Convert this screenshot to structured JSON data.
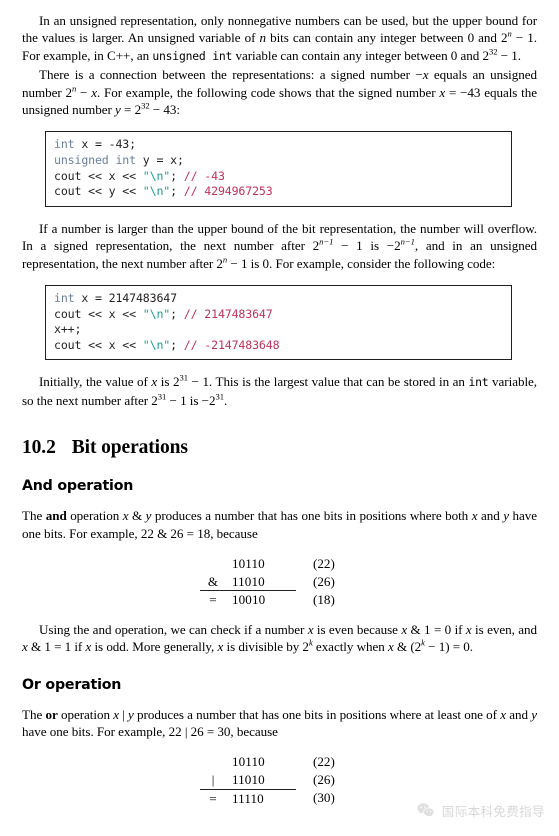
{
  "document": {
    "paragraphs": {
      "p1": {
        "seg1": "In an unsigned representation, only nonnegative numbers can be used, but the upper bound for the values is larger. An unsigned variable of ",
        "var_n": "n",
        "seg2": " bits can contain any integer between 0 and 2",
        "exp_n": "n",
        "seg3": " − 1. For example, in C++, an ",
        "code_unsigned_int": "unsigned int",
        "seg4": " variable can contain any integer between 0 and 2",
        "exp_32": "32",
        "seg5": " − 1."
      },
      "p2": {
        "seg1": "There is a connection between the representations: a signed number −",
        "var_x1": "x",
        "seg2": " equals an unsigned number 2",
        "exp_n": "n",
        "seg3": " − ",
        "var_x2": "x",
        "seg4": ". For example, the following code shows that the signed number ",
        "var_x3": "x",
        "seg5": " = −43 equals the unsigned number ",
        "var_y": "y",
        "seg6": " = 2",
        "exp_32": "32",
        "seg7": " − 43:"
      },
      "p3": {
        "seg1": "If a number is larger than the upper bound of the bit representation, the number will overflow. In a signed representation, the next number after 2",
        "exp_nm1_a": "n−1",
        "seg2": " − 1 is −2",
        "exp_nm1_b": "n−1",
        "seg3": ", and in an unsigned representation, the next number after 2",
        "exp_n": "n",
        "seg4": " − 1 is 0. For example, consider the following code:"
      },
      "p4": {
        "seg1": "Initially, the value of ",
        "var_x1": "x",
        "seg2": " is 2",
        "exp_31_a": "31",
        "seg3": " − 1. This is the largest value that can be stored in an ",
        "code_int": "int",
        "seg4": " variable, so the next number after 2",
        "exp_31_b": "31",
        "seg5": " − 1 is −2",
        "exp_31_c": "31",
        "seg6": "."
      },
      "p5": {
        "seg1": "The ",
        "bold_and": "and",
        "seg2": " operation ",
        "var_x1": "x",
        "seg3": " & ",
        "var_y1": "y",
        "seg4": " produces a number that has one bits in positions where both ",
        "var_x2": "x",
        "seg5": " and ",
        "var_y2": "y",
        "seg6": " have one bits. For example, 22 & 26 = 18, because"
      },
      "p6": {
        "seg1": "Using the and operation, we can check if a number ",
        "var_x1": "x",
        "seg2": " is even because ",
        "var_x2": "x",
        "seg3": " & 1 = 0 if ",
        "var_x3": "x",
        "seg4": " is even, and ",
        "var_x4": "x",
        "seg5": " & 1 = 1 if ",
        "var_x5": "x",
        "seg6": " is odd. More generally, ",
        "var_x6": "x",
        "seg7": " is divisible by 2",
        "exp_k_a": "k",
        "seg8": " exactly when ",
        "var_x7": "x",
        "seg9": " & (2",
        "exp_k_b": "k",
        "seg10": " − 1) = 0."
      },
      "p7": {
        "seg1": "The ",
        "bold_or": "or",
        "seg2": " operation ",
        "var_x1": "x",
        "seg3": " | ",
        "var_y1": "y",
        "seg4": " produces a number that has one bits in positions where at least one of ",
        "var_x2": "x",
        "seg5": " and ",
        "var_y2": "y",
        "seg6": " have one bits. For example, 22 | 26 = 30, because"
      }
    },
    "code_block_1": {
      "lines": [
        {
          "kw": "int",
          "plain1": " x = -43;",
          "str": "",
          "plain2": "",
          "cmt": ""
        },
        {
          "kw": "unsigned int",
          "plain1": " y = x;",
          "str": "",
          "plain2": "",
          "cmt": ""
        },
        {
          "kw": "",
          "plain1": "cout << x << ",
          "str": "\"\\n\"",
          "plain2": "; ",
          "cmt": "// -43"
        },
        {
          "kw": "",
          "plain1": "cout << y << ",
          "str": "\"\\n\"",
          "plain2": "; ",
          "cmt": "// 4294967253"
        }
      ]
    },
    "code_block_2": {
      "lines": [
        {
          "kw": "int",
          "plain1": " x = 2147483647",
          "str": "",
          "plain2": "",
          "cmt": ""
        },
        {
          "kw": "",
          "plain1": "cout << x << ",
          "str": "\"\\n\"",
          "plain2": "; ",
          "cmt": "// 2147483647"
        },
        {
          "kw": "",
          "plain1": "x++;",
          "str": "",
          "plain2": "",
          "cmt": ""
        },
        {
          "kw": "",
          "plain1": "cout << x << ",
          "str": "\"\\n\"",
          "plain2": "; ",
          "cmt": "// -2147483648"
        }
      ]
    },
    "headings": {
      "section_number": "10.2",
      "section_title": "Bit operations",
      "sub_and": "And operation",
      "sub_or": "Or operation"
    },
    "and_table": {
      "rows": [
        {
          "op": "",
          "bits": "10110",
          "dec": "(22)"
        },
        {
          "op": "&",
          "bits": "11010",
          "dec": "(26)"
        },
        {
          "op": "=",
          "bits": "10010",
          "dec": "(18)"
        }
      ]
    },
    "or_table": {
      "rows": [
        {
          "op": "",
          "bits": "10110",
          "dec": "(22)"
        },
        {
          "op": "|",
          "bits": "11010",
          "dec": "(26)"
        },
        {
          "op": "=",
          "bits": "11110",
          "dec": "(30)"
        }
      ]
    },
    "watermark": {
      "icon": "wechat-icon",
      "text": "国际本科免费指导"
    },
    "colors": {
      "keyword": "#6b7f9e",
      "string": "#1f9e8f",
      "comment": "#c0325a",
      "text": "#231f20",
      "background": "#ffffff"
    }
  }
}
